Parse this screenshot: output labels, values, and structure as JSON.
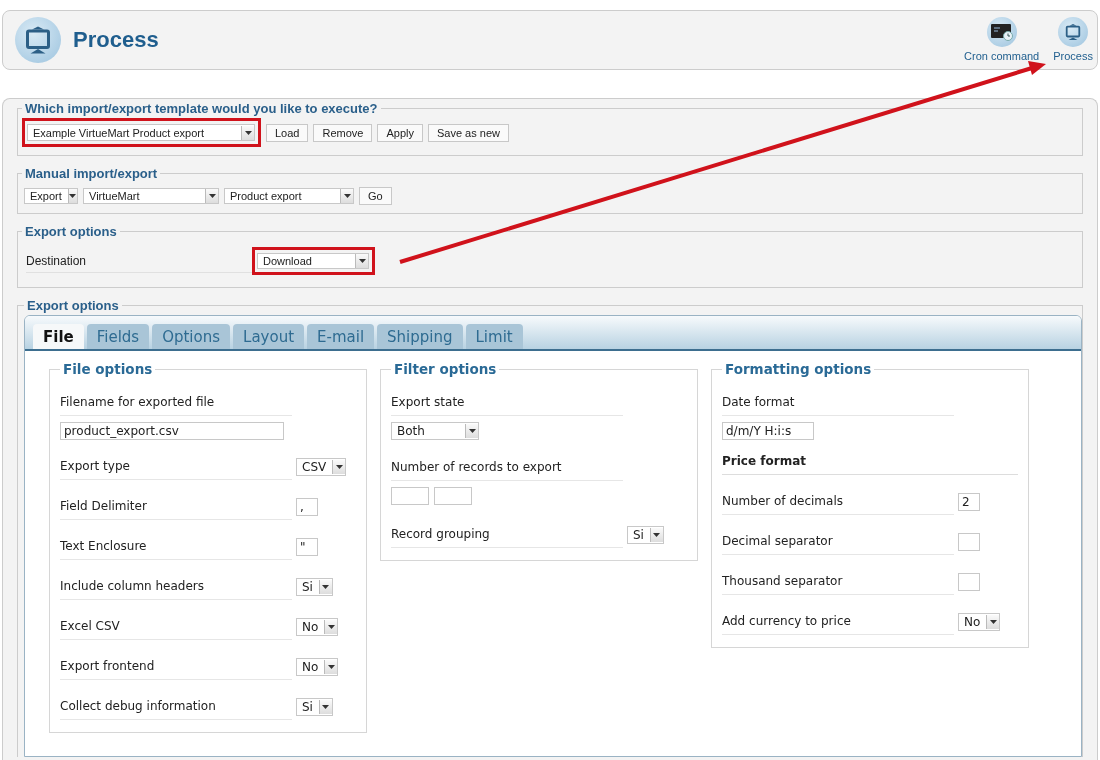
{
  "header": {
    "title": "Process",
    "toolbar": [
      {
        "kind": "cron",
        "label": "Cron command"
      },
      {
        "kind": "process",
        "label": "Process"
      }
    ]
  },
  "template_section": {
    "legend": "Which import/export template would you like to execute?",
    "select": {
      "value": "Example VirtueMart Product export",
      "highlighted": true
    },
    "buttons": [
      "Load",
      "Remove",
      "Apply",
      "Save as new"
    ]
  },
  "manual_section": {
    "legend": "Manual import/export",
    "selects": [
      "Export",
      "VirtueMart",
      "Product export"
    ],
    "button": "Go"
  },
  "destination_section": {
    "legend": "Export options",
    "label": "Destination",
    "select": {
      "value": "Download",
      "highlighted": true
    }
  },
  "annotation_arrow": true,
  "export_options": {
    "legend": "Export options",
    "tabs": [
      {
        "label": "File",
        "selected": true
      },
      {
        "label": "Fields",
        "selected": false
      },
      {
        "label": "Options",
        "selected": false
      },
      {
        "label": "Layout",
        "selected": false
      },
      {
        "label": "E-mail",
        "selected": false
      },
      {
        "label": "Shipping",
        "selected": false
      },
      {
        "label": "Limit",
        "selected": false
      }
    ],
    "groups": [
      {
        "legend": "File options",
        "rows": [
          {
            "kind": "wide_field",
            "label": "Filename for exported file",
            "value": "product_export.csv"
          },
          {
            "kind": "select",
            "label": "Export type",
            "value": "CSV"
          },
          {
            "kind": "small_input",
            "label": "Field Delimiter",
            "value": ","
          },
          {
            "kind": "small_input",
            "label": "Text Enclosure",
            "value": "\""
          },
          {
            "kind": "select",
            "label": "Include column headers",
            "value": "Si"
          },
          {
            "kind": "select",
            "label": "Excel CSV",
            "value": "No"
          },
          {
            "kind": "select",
            "label": "Export frontend",
            "value": "No"
          },
          {
            "kind": "select",
            "label": "Collect debug information",
            "value": "Si"
          }
        ]
      },
      {
        "legend": "Filter options",
        "rows": [
          {
            "kind": "select_below",
            "label": "Export state",
            "value": "Both"
          },
          {
            "kind": "range",
            "label": "Number of records to export"
          },
          {
            "kind": "select",
            "label": "Record grouping",
            "value": "Si"
          }
        ]
      },
      {
        "legend": "Formatting options",
        "rows": [
          {
            "kind": "field",
            "label": "Date format",
            "value": "d/m/Y H:i:s"
          },
          {
            "kind": "heading",
            "label": "Price format"
          },
          {
            "kind": "small_input",
            "label": "Number of decimals",
            "value": "2"
          },
          {
            "kind": "small_input",
            "label": "Decimal separator"
          },
          {
            "kind": "small_input",
            "label": "Thousand separator"
          },
          {
            "kind": "select",
            "label": "Add currency to price",
            "value": "No"
          }
        ]
      }
    ]
  }
}
